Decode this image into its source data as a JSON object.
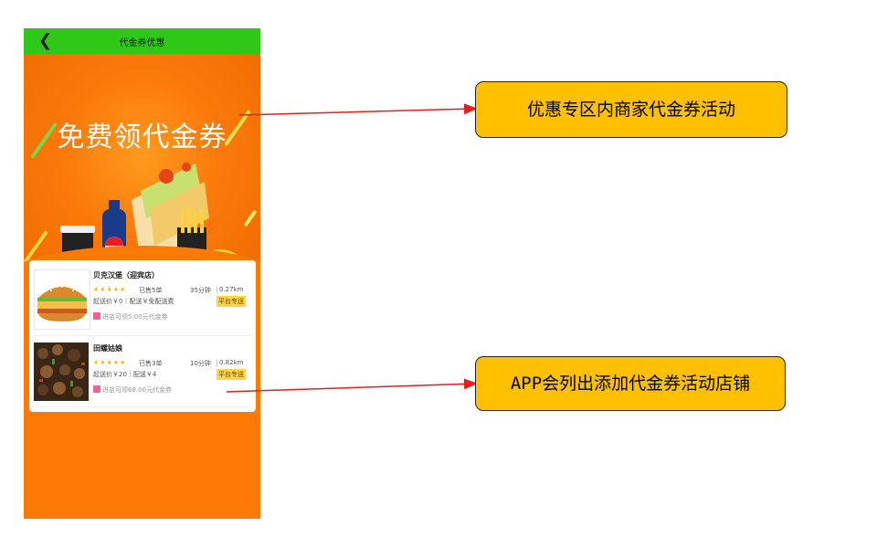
{
  "navbar": {
    "back_icon": "chevron-left-icon",
    "title": "代金券优惠"
  },
  "banner": {
    "title": "免费领代金券"
  },
  "shops": [
    {
      "name": "贝克汉堡（迎宾店）",
      "stars": "★★★★★",
      "sold": "已售5单",
      "eta": "35分钟",
      "distance": "0.27km",
      "fee": "起送价￥0｜配送￥免配送费",
      "tag": "平台专送",
      "coupon": "进店可领5.00元代金券",
      "image": "burger-image"
    },
    {
      "name": "田螺姑娘",
      "stars": "★★★★★",
      "sold": "已售3单",
      "eta": "10分钟",
      "distance": "0.82km",
      "fee": "起送价￥20｜配送￥4",
      "tag": "平台专送",
      "coupon": "进店可领68.00元代金券",
      "image": "snails-image"
    }
  ],
  "callouts": [
    {
      "text": "优惠专区内商家代金券活动"
    },
    {
      "text": "APP会列出添加代金券活动店铺"
    }
  ],
  "colors": {
    "navbar": "#2fc718",
    "page_bg": "#fd7a06",
    "callout_bg": "#ffc000",
    "arrow": "#e02020",
    "tag_bg": "#ffd44a"
  }
}
